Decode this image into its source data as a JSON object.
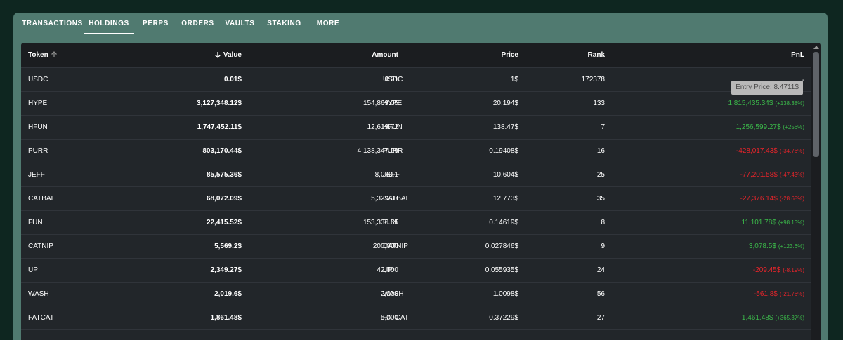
{
  "tabs": [
    {
      "label": "TRANSACTIONS"
    },
    {
      "label": "HOLDINGS"
    },
    {
      "label": "PERPS"
    },
    {
      "label": "ORDERS"
    },
    {
      "label": "VAULTS"
    },
    {
      "label": "STAKING"
    },
    {
      "label": "MORE"
    }
  ],
  "active_tab": "HOLDINGS",
  "columns": {
    "token": "Token",
    "value": "Value",
    "amount": "Amount",
    "price": "Price",
    "rank": "Rank",
    "pnl": "PnL"
  },
  "rows": [
    {
      "token": "USDC",
      "value": "0.01$",
      "amount": "0.01",
      "symbol": "USDC",
      "price": "1$",
      "rank": "172378",
      "pnl": "",
      "pnl_pct": "",
      "pnl_sign": "none"
    },
    {
      "token": "HYPE",
      "value": "3,127,348.12$",
      "amount": "154,869.05",
      "symbol": "HYPE",
      "price": "20.194$",
      "rank": "133",
      "pnl": "1,815,435.34$",
      "pnl_pct": "(+138.38%)",
      "pnl_sign": "pos"
    },
    {
      "token": "HFUN",
      "value": "1,747,452.11$",
      "amount": "12,619.72",
      "symbol": "HFUN",
      "price": "138.47$",
      "rank": "7",
      "pnl": "1,256,599.27$",
      "pnl_pct": "(+256%)",
      "pnl_sign": "pos"
    },
    {
      "token": "PURR",
      "value": "803,170.44$",
      "amount": "4,138,347.29",
      "symbol": "PURR",
      "price": "0.19408$",
      "rank": "16",
      "pnl": "-428,017.43$",
      "pnl_pct": "(-34.76%)",
      "pnl_sign": "neg"
    },
    {
      "token": "JEFF",
      "value": "85,575.36$",
      "amount": "8,070.1",
      "symbol": "JEFF",
      "price": "10.604$",
      "rank": "25",
      "pnl": "-77,201.58$",
      "pnl_pct": "(-47.43%)",
      "pnl_sign": "neg"
    },
    {
      "token": "CATBAL",
      "value": "68,072.09$",
      "amount": "5,329.37",
      "symbol": "CATBAL",
      "price": "12.773$",
      "rank": "35",
      "pnl": "-27,376.14$",
      "pnl_pct": "(-28.68%)",
      "pnl_sign": "neg"
    },
    {
      "token": "FUN",
      "value": "22,415.52$",
      "amount": "153,336.65",
      "symbol": "FUN",
      "price": "0.14619$",
      "rank": "8",
      "pnl": "11,101.78$",
      "pnl_pct": "(+98.13%)",
      "pnl_sign": "pos"
    },
    {
      "token": "CATNIP",
      "value": "5,569.2$",
      "amount": "200,000",
      "symbol": "CATNIP",
      "price": "0.027846$",
      "rank": "9",
      "pnl": "3,078.5$",
      "pnl_pct": "(+123.6%)",
      "pnl_sign": "pos"
    },
    {
      "token": "UP",
      "value": "2,349.27$",
      "amount": "42,000",
      "symbol": "UP",
      "price": "0.055935$",
      "rank": "24",
      "pnl": "-209.45$",
      "pnl_pct": "(-8.19%)",
      "pnl_sign": "neg"
    },
    {
      "token": "WASH",
      "value": "2,019.6$",
      "amount": "2,000",
      "symbol": "WASH",
      "price": "1.0098$",
      "rank": "56",
      "pnl": "-561.8$",
      "pnl_pct": "(-21.76%)",
      "pnl_sign": "neg"
    },
    {
      "token": "FATCAT",
      "value": "1,861.48$",
      "amount": "5,000",
      "symbol": "FATCAT",
      "price": "0.37229$",
      "rank": "27",
      "pnl": "1,461.48$",
      "pnl_pct": "(+365.37%)",
      "pnl_sign": "pos"
    }
  ],
  "tooltip": {
    "text": "Entry Price: 8.4711$",
    "dash": "-"
  },
  "colors": {
    "positive": "#3bb84a",
    "negative": "#e8242a",
    "header_bg": "#507a70",
    "page_bg": "#0e2620"
  },
  "icons": {
    "token_sort": "arrow-up-icon",
    "value_sort": "arrow-down-icon"
  }
}
